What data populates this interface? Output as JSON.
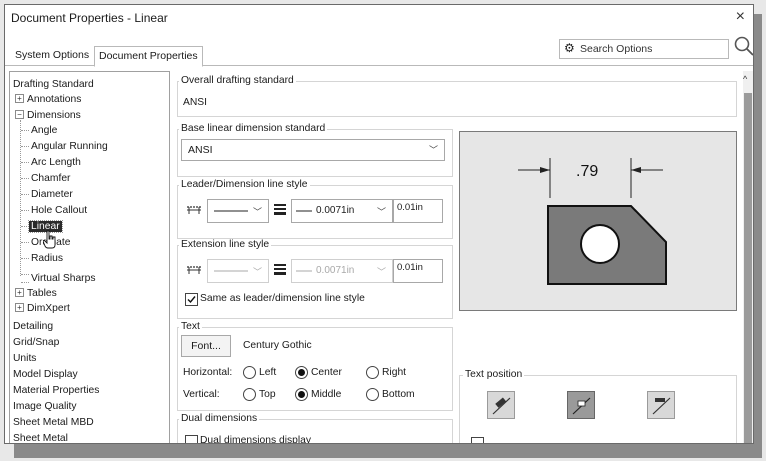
{
  "window": {
    "title": "Document Properties - Linear",
    "close": "×"
  },
  "tabs": [
    "System Options",
    "Document Properties"
  ],
  "search": {
    "placeholder": "Search Options"
  },
  "tree": {
    "drafting_standard": "Drafting Standard",
    "annotations": "Annotations",
    "dimensions": "Dimensions",
    "dim_children": [
      "Angle",
      "Angular Running",
      "Arc Length",
      "Chamfer",
      "Diameter",
      "Hole Callout",
      "Linear",
      "Ordinate",
      "Radius"
    ],
    "virtual_sharps": "Virtual Sharps",
    "tables": "Tables",
    "dimxpert": "DimXpert",
    "root_items": [
      "Detailing",
      "Grid/Snap",
      "Units",
      "Model Display",
      "Material Properties",
      "Image Quality",
      "Sheet Metal MBD",
      "Sheet Metal"
    ],
    "selected": "Linear"
  },
  "overall": {
    "label": "Overall drafting standard",
    "value": "ANSI"
  },
  "base_linear": {
    "label": "Base linear dimension standard",
    "value": "ANSI"
  },
  "leader": {
    "label": "Leader/Dimension line style",
    "thickness": "0.0071in",
    "custom": "0.01in"
  },
  "extension": {
    "label": "Extension line style",
    "thickness": "0.0071in",
    "custom": "0.01in",
    "same_as_label": "Same as leader/dimension line style",
    "same_checked": true
  },
  "text": {
    "label": "Text",
    "font_button": "Font...",
    "font_name": "Century Gothic",
    "horizontal_label": "Horizontal:",
    "horizontal_options": [
      "Left",
      "Center",
      "Right"
    ],
    "horizontal_selected": "Center",
    "vertical_label": "Vertical:",
    "vertical_options": [
      "Top",
      "Middle",
      "Bottom"
    ],
    "vertical_selected": "Middle"
  },
  "dual": {
    "label": "Dual dimensions",
    "checkbox_label": "Dual dimensions display"
  },
  "preview": {
    "dim_value": ".79"
  },
  "text_position": {
    "label": "Text position"
  },
  "colors": {
    "part_fill": "#7a7a7a",
    "selection": "#2a2a2a"
  }
}
